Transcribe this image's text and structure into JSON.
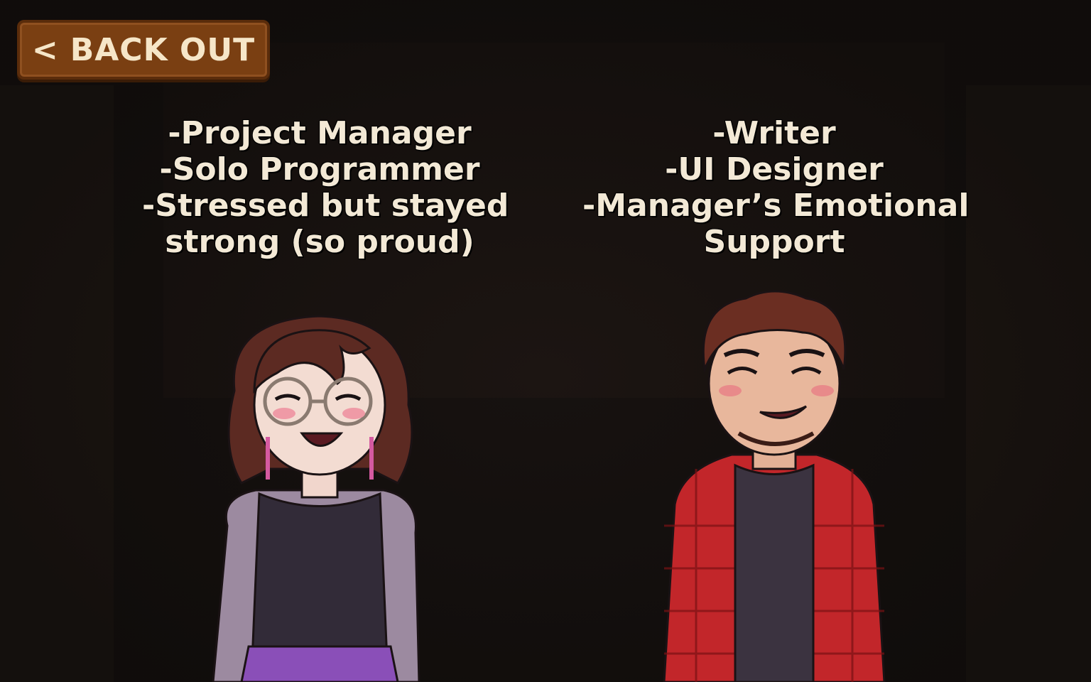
{
  "back_button": {
    "chevron": "<",
    "label": "BACK OUT"
  },
  "left_credit": {
    "lines": [
      "-Project Manager",
      "-Solo Programmer",
      "-Stressed but stayed",
      "strong (so proud)"
    ]
  },
  "right_credit": {
    "lines": [
      "-Writer",
      "-UI Designer",
      "-Manager’s Emotional",
      "Support"
    ]
  },
  "colors": {
    "button_bg": "#7a3f12",
    "text": "#f3e9d6",
    "left_shirt": "#322b38",
    "left_cardigan": "#9c8aa0",
    "left_skirt": "#8a4fb8",
    "right_flannel": "#c2262a",
    "right_shirt": "#3b3340"
  }
}
